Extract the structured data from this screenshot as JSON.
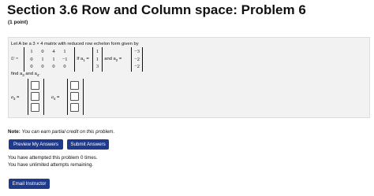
{
  "header": {
    "title": "Section 3.6 Row and Column space: Problem 6",
    "points": "(1 point)"
  },
  "problem": {
    "intro": "Let A be a 3 × 4 matrix with reduced row echelon form given by",
    "u_label": "U =",
    "u_matrix": [
      [
        "1",
        "0",
        "4",
        "1"
      ],
      [
        "0",
        "1",
        "1",
        "−1"
      ],
      [
        "0",
        "0",
        "0",
        "0"
      ]
    ],
    "if_label": ". If a",
    "a1_sub": "1",
    "eq": " =",
    "a1_vector": [
      "1",
      "1",
      "3"
    ],
    "and_label": ", and a",
    "a2_sub": "2",
    "a2_vector": [
      "−3",
      "−2",
      "−2"
    ],
    "find_text": "find a",
    "find_sub3": "3",
    "find_and": " and a",
    "find_sub4": "4",
    "find_period": ".",
    "a3_label": "a",
    "a3_sub": "3",
    "a4_label": "a",
    "a4_sub": "4",
    "answer_eq": " ="
  },
  "note": {
    "label": "Note:",
    "text": "You can earn partial credit on this problem."
  },
  "buttons": {
    "preview": "Preview My Answers",
    "submit": "Submit Answers",
    "email": "Email Instructor"
  },
  "status": {
    "attempts": "You have attempted this problem 0 times.",
    "remaining": "You have unlimited attempts remaining."
  }
}
